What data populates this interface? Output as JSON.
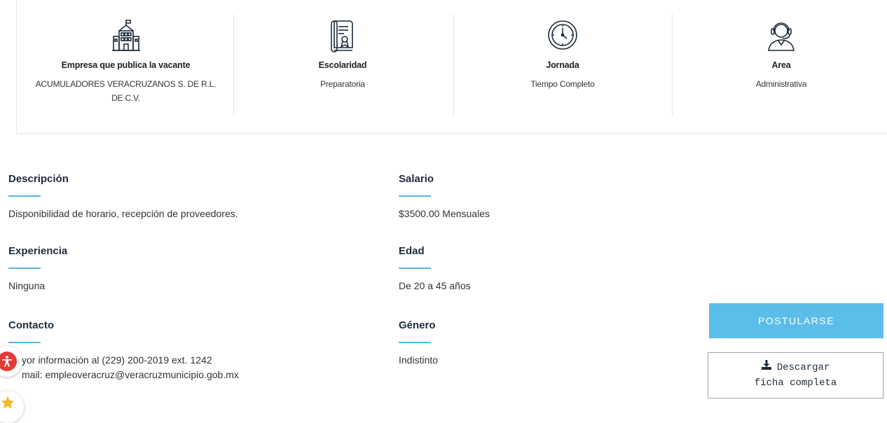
{
  "summary": {
    "cards": [
      {
        "icon": "building-icon",
        "label": "Empresa que publica la vacante",
        "value": "ACUMULADORES VERACRUZANOS S. DE R.L. DE C.V."
      },
      {
        "icon": "certificate-icon",
        "label": "Escolaridad",
        "value": "Preparatoria"
      },
      {
        "icon": "clock-icon",
        "label": "Jornada",
        "value": "Tiempo Completo"
      },
      {
        "icon": "headset-agent-icon",
        "label": "Area",
        "value": "Administrativa"
      }
    ]
  },
  "details": {
    "descripcion": {
      "title": "Descripción",
      "text": "Disponibilidad de horario, recepción de proveedores."
    },
    "salario": {
      "title": "Salario",
      "text": "$3500.00 Mensuales"
    },
    "experiencia": {
      "title": "Experiencia",
      "text": "Ninguna"
    },
    "edad": {
      "title": "Edad",
      "text": "De 20 a 45 años"
    },
    "contacto": {
      "title": "Contacto",
      "line1": "yor información al (229) 200-2019 ext. 1242",
      "line2": "mail: empleoveracruz@veracruzmunicipio.gob.mx"
    },
    "genero": {
      "title": "Género",
      "text": "Indistinto"
    }
  },
  "actions": {
    "apply_label": "POSTULARSE",
    "download_line1": "Descargar",
    "download_line2": "ficha completa"
  },
  "colors": {
    "accent": "#5bbde9",
    "rule": "#56b6e2",
    "text_dark": "#1d2b3a",
    "a11y": "#e53935",
    "star": "#f5b82e"
  }
}
